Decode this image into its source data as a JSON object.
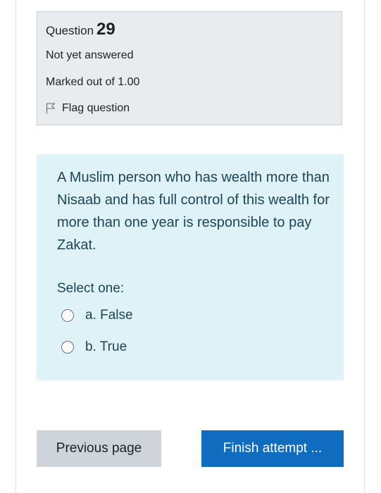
{
  "question_info": {
    "question_label": "Question",
    "question_number": "29",
    "state": "Not yet answered",
    "grade": "Marked out of 1.00",
    "flag_label": "Flag question",
    "flag_icon": "flag-outline-icon"
  },
  "question": {
    "text": "A Muslim person who has wealth more than Nisaab and has full control of this wealth for more than one year is responsible to pay Zakat.",
    "prompt": "Select one:",
    "options": [
      {
        "label": "a. False",
        "selected": false
      },
      {
        "label": "b. True",
        "selected": false
      }
    ]
  },
  "navigation": {
    "previous_label": "Previous page",
    "finish_label": "Finish attempt ..."
  },
  "colors": {
    "info_background": "#e9ecef",
    "content_background": "#def2f8",
    "primary_button": "#0f6cbf",
    "secondary_button": "#ced4da",
    "question_text": "#1d4457"
  }
}
